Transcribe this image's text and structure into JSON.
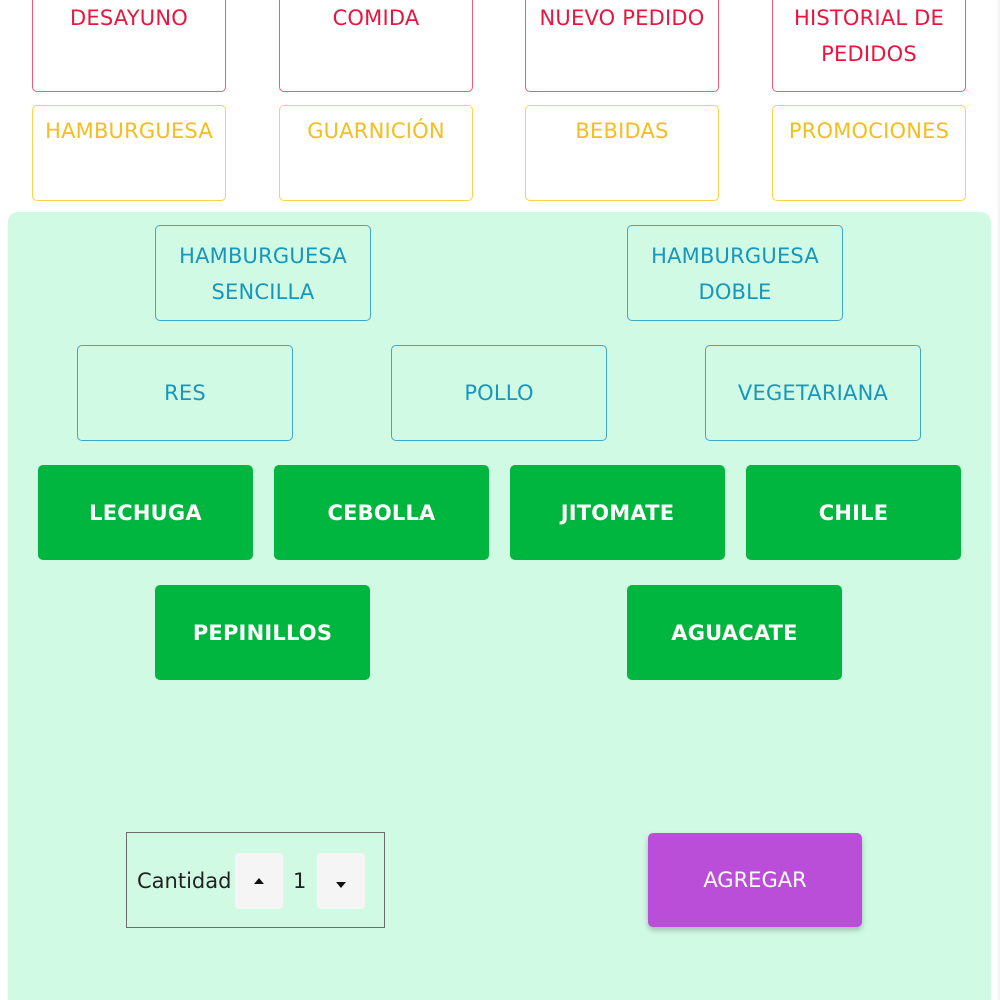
{
  "top_menu": {
    "row1": [
      "DESAYUNO",
      "COMIDA",
      "NUEVO PEDIDO",
      [
        "HISTORIAL DE",
        "PEDIDOS"
      ]
    ],
    "row2": [
      "HAMBURGUESA",
      "GUARNICIÓN",
      "BEBIDAS",
      "PROMOCIONES"
    ]
  },
  "burger_types": {
    "sencilla": [
      "HAMBURGUESA",
      "SENCILLA"
    ],
    "doble": [
      "HAMBURGUESA",
      "DOBLE"
    ]
  },
  "proteins": [
    "RES",
    "POLLO",
    "VEGETARIANA"
  ],
  "ingredients": [
    "LECHUGA",
    "CEBOLLA",
    "JITOMATE",
    "CHILE",
    "PEPINILLOS",
    "AGUACATE"
  ],
  "quantity": {
    "label": "Cantidad",
    "value": "1"
  },
  "add_button": {
    "label": "AGREGAR"
  },
  "colors": {
    "menu_red": "#e8163e",
    "menu_yellow": "#f5bd1e",
    "panel_bg": "#d1fae5",
    "option_teal": "#1797bb",
    "ingredient_green": "#00b63e",
    "add_purple": "#bb4ed8"
  },
  "icons": {
    "increment": "caret-up-icon",
    "decrement": "caret-down-icon"
  }
}
